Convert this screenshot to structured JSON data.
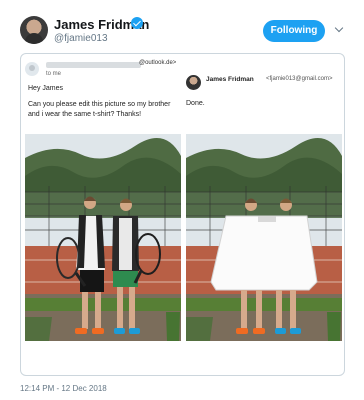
{
  "tweet": {
    "author_name": "James Fridman",
    "author_handle": "@fjamie013",
    "follow_label": "Following",
    "timestamp": "12:14 PM - 12 Dec 2018"
  },
  "email": {
    "sender_domain": "@outlook.de>",
    "recipient": "to me",
    "greeting": "Hey James",
    "message": "Can you please edit this picture so my brother and i wear the same t-shirt? Thanks!"
  },
  "reply": {
    "name": "James Fridman",
    "email": "<fjamie013@gmail.com>",
    "text": "Done."
  },
  "icons": {
    "verified": "verified-badge-icon",
    "caret": "chevron-down-icon",
    "sender": "person-icon"
  },
  "colors": {
    "accent": "#1da1f2",
    "text": "#14171a",
    "muted": "#657786",
    "border": "#ccd6dd"
  }
}
